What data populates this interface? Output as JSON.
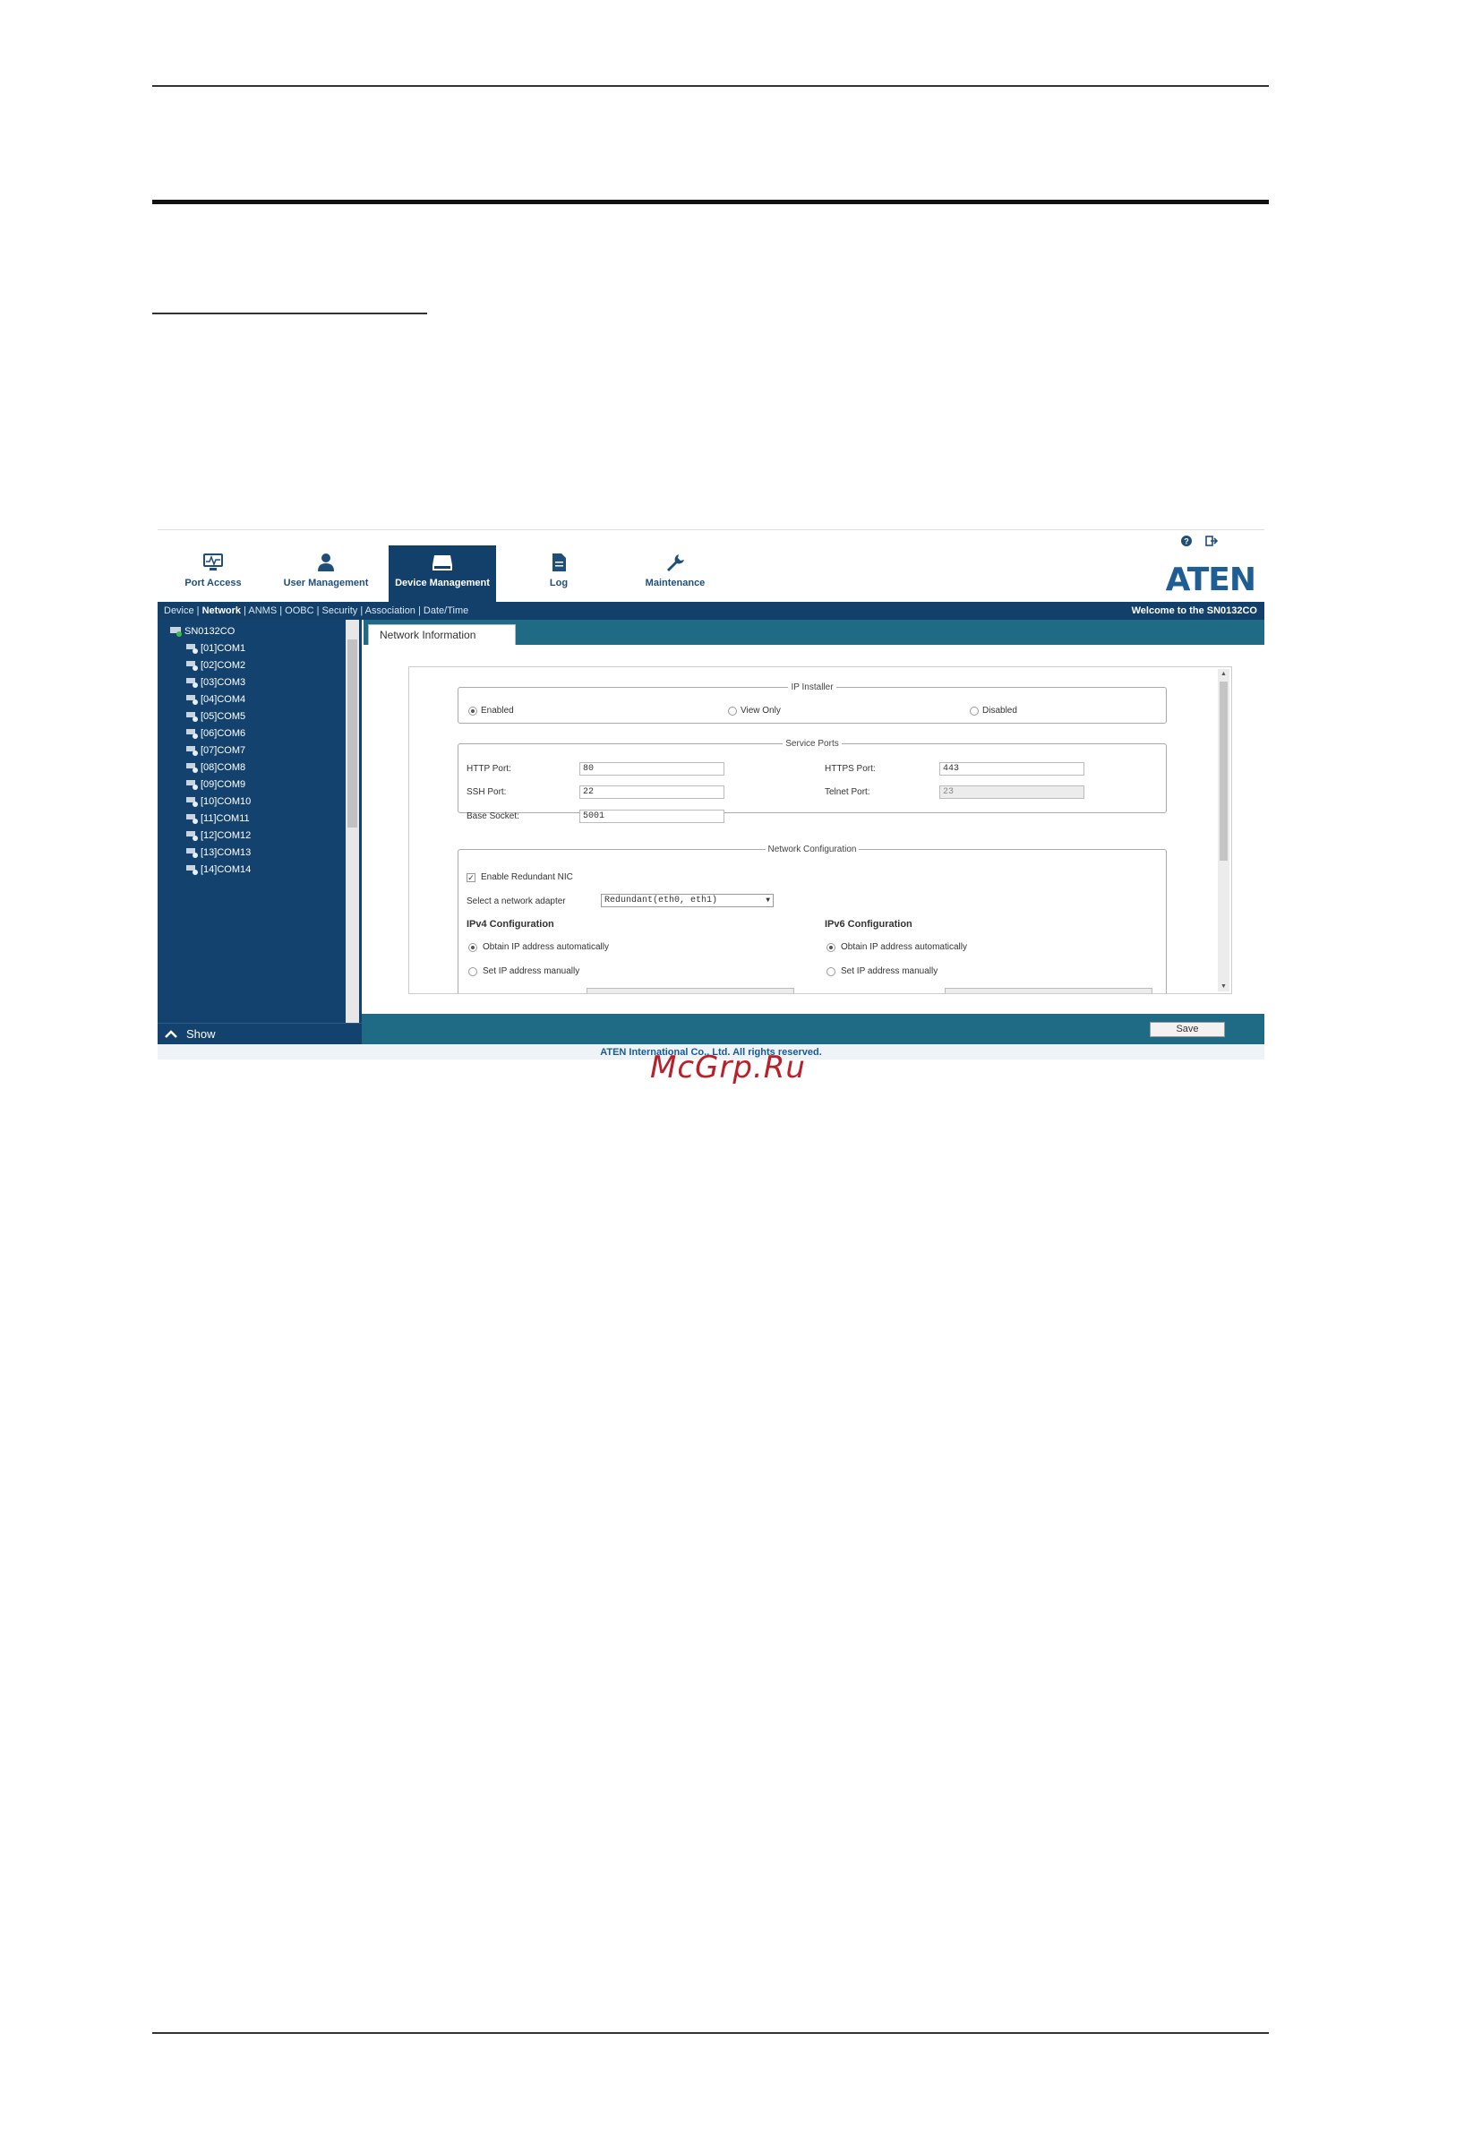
{
  "app": {
    "nav": [
      {
        "label": "Port Access",
        "icon": "monitor-icon"
      },
      {
        "label": "User Management",
        "icon": "user-icon"
      },
      {
        "label": "Device Management",
        "icon": "device-icon"
      },
      {
        "label": "Log",
        "icon": "document-icon"
      },
      {
        "label": "Maintenance",
        "icon": "wrench-icon"
      }
    ],
    "logo_text": "ATEN",
    "subnav": {
      "items": [
        "Device",
        "Network",
        "ANMS",
        "OOBC",
        "Security",
        "Association",
        "Date/Time"
      ],
      "selected": "Network",
      "welcome": "Welcome to the SN0132CO"
    },
    "sidebar": {
      "root": "SN0132CO",
      "items": [
        "[01]COM1",
        "[02]COM2",
        "[03]COM3",
        "[04]COM4",
        "[05]COM5",
        "[06]COM6",
        "[07]COM7",
        "[08]COM8",
        "[09]COM9",
        "[10]COM10",
        "[11]COM11",
        "[12]COM12",
        "[13]COM13",
        "[14]COM14"
      ],
      "footer": "Show"
    },
    "tab": "Network Information",
    "ip_installer": {
      "legend": "IP Installer",
      "options": [
        "Enabled",
        "View Only",
        "Disabled"
      ],
      "selected": "Enabled"
    },
    "service_ports": {
      "legend": "Service Ports",
      "http_label": "HTTP Port:",
      "http_value": "80",
      "https_label": "HTTPS Port:",
      "https_value": "443",
      "ssh_label": "SSH Port:",
      "ssh_value": "22",
      "telnet_label": "Telnet Port:",
      "telnet_value": "23",
      "socket_label": "Base Socket:",
      "socket_value": "5001"
    },
    "network_config": {
      "legend": "Network Configuration",
      "redundant_label": "Enable Redundant NIC",
      "redundant_checked": true,
      "adapter_label": "Select a network adapter",
      "adapter_value": "Redundant(eth0, eth1)",
      "ipv4_title": "IPv4 Configuration",
      "ipv6_title": "IPv6 Configuration",
      "auto_label": "Obtain IP address automatically",
      "manual_label": "Set IP address manually"
    },
    "save_label": "Save",
    "copyright": "ATEN International Co., Ltd. All rights reserved."
  },
  "watermark": "McGrp.Ru"
}
